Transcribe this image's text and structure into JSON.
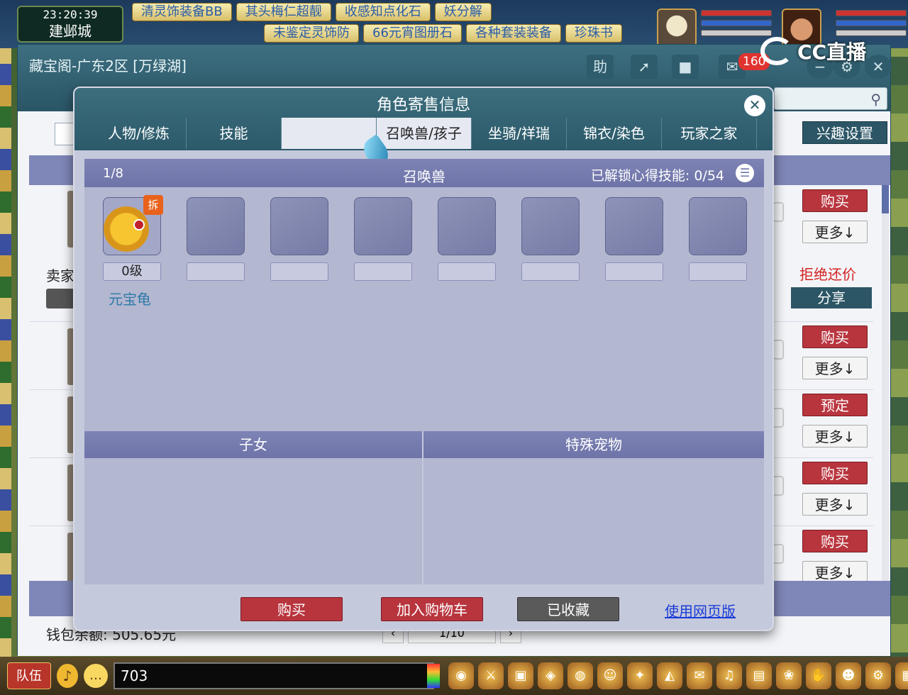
{
  "game": {
    "clock_time": "23:20:39",
    "city": "建邺城",
    "ticker_row1": [
      "清灵饰装备BB",
      "其头梅仁超靓",
      "收感知点化石",
      "妖分解"
    ],
    "ticker_row2": [
      "未鉴定灵饰防",
      "66元宵图册石",
      "各种套装装备",
      "珍珠书"
    ],
    "stream_logo": "CC直播",
    "chat_value": "703",
    "team_label": "队伍"
  },
  "cbg": {
    "title": "藏宝阁-广东2区 [万绿湖]",
    "help_label": "助",
    "cart_count": "160",
    "interest_button": "兴趣设置",
    "seller_label": "卖家",
    "refuse_bargain": "拒绝还价",
    "share_button": "分享",
    "wallet_label": "钱包余额: 505.65元",
    "page_indicator": "1/10",
    "actions": [
      {
        "primary": "购买",
        "more": "更多↓"
      },
      {
        "primary": "购买",
        "more": "更多↓"
      },
      {
        "primary": "预定",
        "more": "更多↓"
      },
      {
        "primary": "购买",
        "more": "更多↓"
      },
      {
        "primary": "购买",
        "more": "更多↓"
      }
    ]
  },
  "modal": {
    "title": "角色寄售信息",
    "tabs": [
      "人物/修炼",
      "技能",
      "",
      "召唤兽/孩子",
      "坐骑/祥瑞",
      "锦衣/染色",
      "玩家之家"
    ],
    "active_tab": "召唤兽/孩子",
    "pets": {
      "count": "1/8",
      "heading": "召唤兽",
      "skills": "已解锁心得技能: 0/54",
      "items": [
        {
          "name": "元宝龟",
          "level": "0级",
          "badge": "拆"
        }
      ]
    },
    "children_heading": "子女",
    "special_pets_heading": "特殊宠物",
    "buy_button": "购买",
    "add_cart_button": "加入购物车",
    "favorited_button": "已收藏",
    "web_version_link": "使用网页版"
  },
  "colors": {
    "accent_red": "#b8353e",
    "header_teal": "#2c5a6a",
    "panel_purple": "#6e74a8"
  }
}
